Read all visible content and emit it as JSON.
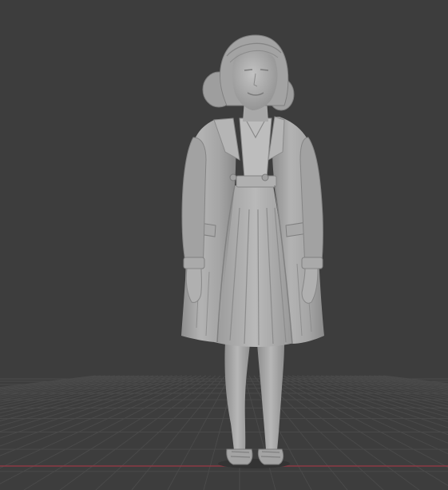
{
  "viewport": {
    "background_color": "#3d3d3d",
    "grid_line_color": "#4a4a4a",
    "x_axis_color": "#8b3a44",
    "y_axis_color": "#5d7a2e"
  },
  "model": {
    "name": "sculpted-figure-woman-in-coat",
    "material_color": "#a9a9a9",
    "shadow_color": "#7a7a7a",
    "highlight_color": "#c4c4c4"
  }
}
